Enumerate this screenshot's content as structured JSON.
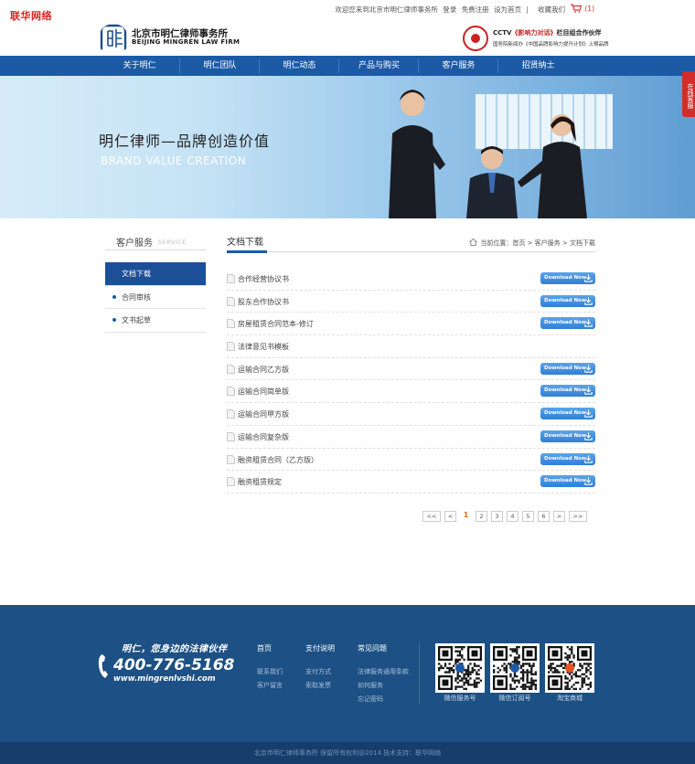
{
  "watermark": "联华网络",
  "top_links": {
    "welcome": "欢迎您来到北京市明仁律师事务所",
    "login": "登录",
    "register": "免费注册",
    "set_home": "设为首页",
    "sep": "|",
    "favorite": "收藏我们",
    "cart_count": "(1)"
  },
  "logo": {
    "name": "北京市明仁律师事务所",
    "en": "BEIJING MINGREN LAW FIRM"
  },
  "partner": {
    "line1_a": "CCTV",
    "line1_b": "《影响力对话》",
    "line1_c": "栏目组合作伙伴",
    "line2": "国务院新闻办《中国品牌影响力提升计划》上榜品牌"
  },
  "nav": [
    "关于明仁",
    "明仁团队",
    "明仁动态",
    "产品与购买",
    "客户服务",
    "招贤纳士"
  ],
  "banner": {
    "title": "明仁律师—品牌创造价值",
    "subtitle": "BRAND VALUE CREATION"
  },
  "side_tab": "在线客服",
  "sidebar": {
    "title_cn": "客户服务",
    "title_en": "SERVICE",
    "items": [
      "文档下载",
      "合同审核",
      "文书起草"
    ]
  },
  "main": {
    "title": "文档下载",
    "breadcrumb": "当前位置：首页 > 客户服务 > 文档下载"
  },
  "download_label": "Download Now",
  "documents": [
    {
      "name": "合作经营协议书",
      "has_download": true
    },
    {
      "name": "股东合作协议书",
      "has_download": true
    },
    {
      "name": "房屋租赁合同范本-修订",
      "has_download": true
    },
    {
      "name": "法律意见书模板",
      "has_download": false
    },
    {
      "name": "运输合同乙方版",
      "has_download": true
    },
    {
      "name": "运输合同简单版",
      "has_download": true
    },
    {
      "name": "运输合同甲方版",
      "has_download": true
    },
    {
      "name": "运输合同复杂版",
      "has_download": true
    },
    {
      "name": "融资租赁合同（乙方版）",
      "has_download": true
    },
    {
      "name": "融资租赁规定",
      "has_download": true
    }
  ],
  "pagination": {
    "first": "<<",
    "prev": "<",
    "pages": [
      "1",
      "2",
      "3",
      "4",
      "5",
      "6"
    ],
    "current": "1",
    "next": ">",
    "last": ">>"
  },
  "footer": {
    "slogan": "明仁，您身边的法律伙伴",
    "phone": "400-776-5168",
    "url": "www.mingrenlvshi.com",
    "columns": [
      {
        "title": "首页",
        "links": [
          "联系我们",
          "客户留言"
        ]
      },
      {
        "title": "支付说明",
        "links": [
          "支付方式",
          "索取发票"
        ]
      },
      {
        "title": "常见问题",
        "links": [
          "法律服务通用条款",
          "如何服务",
          "忘记密码"
        ]
      }
    ],
    "qrcodes": [
      "微信服务号",
      "微信订阅号",
      "淘宝商城"
    ],
    "copyright": "北京市明仁律师事务所 保留所有权利@2014 技术支持：联华网络"
  },
  "colors": {
    "nav_blue": "#1c5aa6",
    "footer_blue": "#1d5084",
    "download_blue": "#2f7fd6",
    "accent_red": "#d42b2b",
    "current_page": "#e56b1f"
  }
}
